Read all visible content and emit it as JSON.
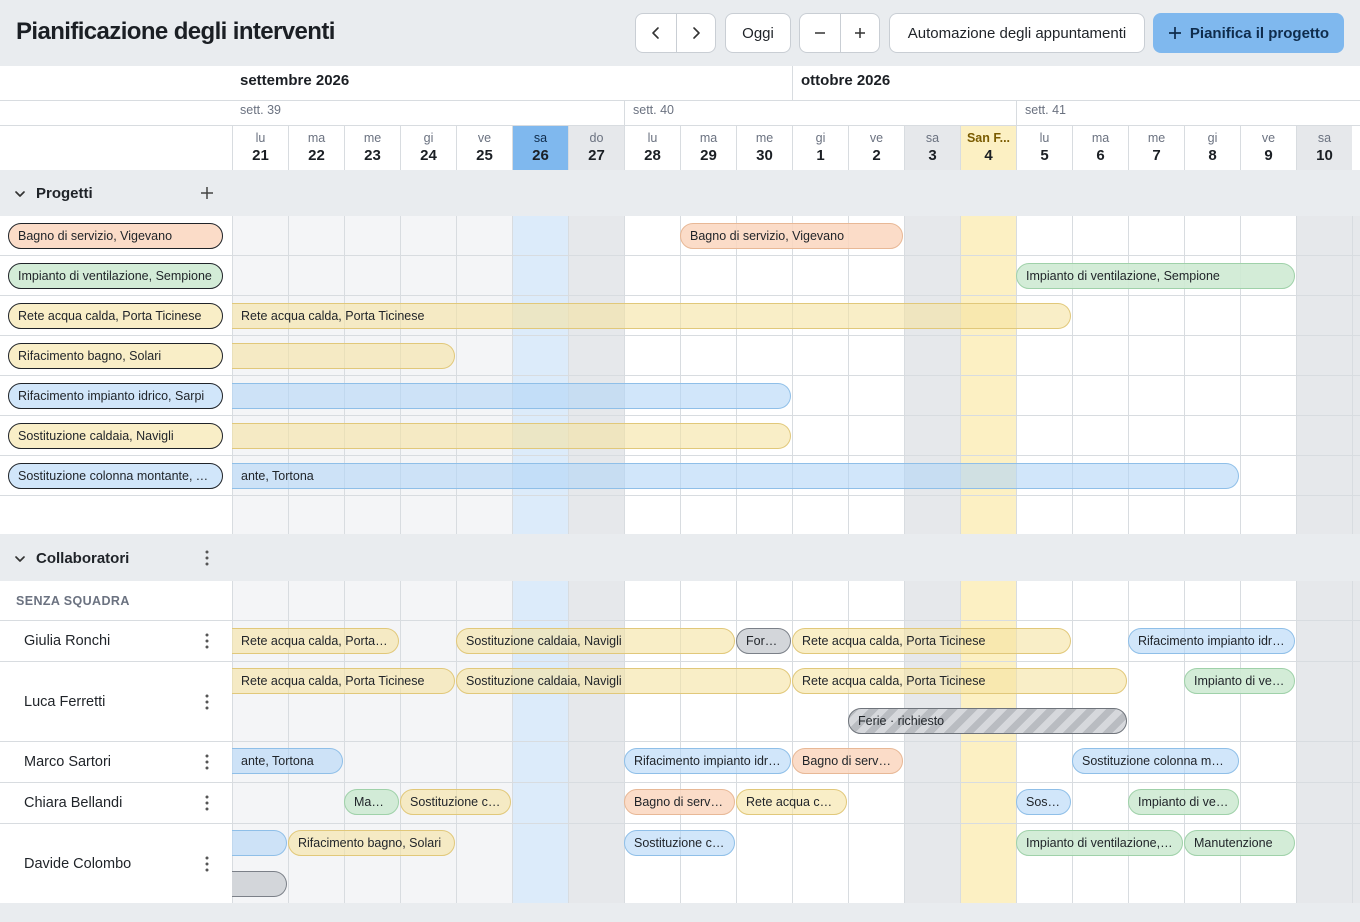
{
  "header": {
    "title": "Pianificazione degli interventi",
    "today_label": "Oggi",
    "automation_label": "Automazione degli appuntamenti",
    "plan_label": "Pianifica il progetto"
  },
  "timeline": {
    "months": [
      "settembre 2026",
      "ottobre 2026"
    ],
    "weeks": [
      "sett. 39",
      "sett. 40",
      "sett. 41"
    ],
    "days": [
      {
        "name": "lu",
        "num": "21"
      },
      {
        "name": "ma",
        "num": "22"
      },
      {
        "name": "me",
        "num": "23"
      },
      {
        "name": "gi",
        "num": "24"
      },
      {
        "name": "ve",
        "num": "25"
      },
      {
        "name": "sa",
        "num": "26"
      },
      {
        "name": "do",
        "num": "27"
      },
      {
        "name": "lu",
        "num": "28"
      },
      {
        "name": "ma",
        "num": "29"
      },
      {
        "name": "me",
        "num": "30"
      },
      {
        "name": "gi",
        "num": "1"
      },
      {
        "name": "ve",
        "num": "2"
      },
      {
        "name": "sa",
        "num": "3"
      },
      {
        "name": "San F...",
        "num": "4"
      },
      {
        "name": "lu",
        "num": "5"
      },
      {
        "name": "ma",
        "num": "6"
      },
      {
        "name": "me",
        "num": "7"
      },
      {
        "name": "gi",
        "num": "8"
      },
      {
        "name": "ve",
        "num": "9"
      },
      {
        "name": "sa",
        "num": "10"
      }
    ]
  },
  "projects": {
    "title": "Progetti",
    "items": [
      {
        "label": "Bagno di servizio, Vigevano",
        "color": "orange"
      },
      {
        "label": "Impianto di ventilazione, Sempione",
        "color": "green"
      },
      {
        "label": "Rete acqua calda, Porta Ticinese",
        "color": "yellow"
      },
      {
        "label": "Rifacimento bagno, Solari",
        "color": "yellow"
      },
      {
        "label": "Rifacimento impianto idrico, Sarpi",
        "color": "blue"
      },
      {
        "label": "Sostituzione caldaia, Navigli",
        "color": "yellow"
      },
      {
        "label": "Sostituzione colonna montante, Tortona",
        "color": "blue"
      }
    ],
    "bars": [
      {
        "text": "Bagno di servizio, Vigevano",
        "color": "orange"
      },
      {
        "text": "Impianto di ventilazione, Sempione",
        "color": "green"
      },
      {
        "text": "Rete acqua calda, Porta Ticinese",
        "color": "yellow"
      },
      {
        "text": "",
        "color": "yellow"
      },
      {
        "text": "",
        "color": "blue"
      },
      {
        "text": "",
        "color": "yellow"
      },
      {
        "text": "ante, Tortona",
        "color": "blue"
      }
    ]
  },
  "collaborators": {
    "title": "Collaboratori",
    "group": "SENZA SQUADRA",
    "people": [
      "Giulia Ronchi",
      "Luca Ferretti",
      "Marco Sartori",
      "Chiara Bellandi",
      "Davide Colombo"
    ],
    "bars": [
      {
        "text": "Rete acqua calda, Porta Ticinese",
        "color": "yellow"
      },
      {
        "text": "Sostituzione caldaia, Navigli",
        "color": "yellow"
      },
      {
        "text": "Formazione",
        "color": "grey"
      },
      {
        "text": "Rete acqua calda, Porta Ticinese",
        "color": "yellow"
      },
      {
        "text": "Rifacimento impianto idrico, Sarpi",
        "color": "blue"
      },
      {
        "text": "Rete acqua calda, Porta Ticinese",
        "color": "yellow"
      },
      {
        "text": "Sostituzione caldaia, Navigli",
        "color": "yellow"
      },
      {
        "text": "Rete acqua calda, Porta Ticinese",
        "color": "yellow"
      },
      {
        "text": "Impianto di ventilazione, Sempione",
        "color": "green"
      },
      {
        "text": "Ferie · richiesto",
        "color": "hatch"
      },
      {
        "text": "ante, Tortona",
        "color": "blue"
      },
      {
        "text": "Rifacimento impianto idrico, Sarpi",
        "color": "blue"
      },
      {
        "text": "Bagno di servizio, Vigevano",
        "color": "orange"
      },
      {
        "text": "Sostituzione colonna montante, Tortona",
        "color": "blue"
      },
      {
        "text": "Manutenzione",
        "color": "green"
      },
      {
        "text": "Sostituzione caldaia, Navigli",
        "color": "yellow"
      },
      {
        "text": "Bagno di servizio, Vigevano",
        "color": "orange"
      },
      {
        "text": "Rete acqua calda, Porta Ticinese",
        "color": "yellow"
      },
      {
        "text": "Sostituzione colonna montante, Tortona",
        "color": "blue"
      },
      {
        "text": "Impianto di ventilazione, Sempione",
        "color": "green"
      },
      {
        "text": "",
        "color": "blue"
      },
      {
        "text": "Rifacimento bagno, Solari",
        "color": "yellow"
      },
      {
        "text": "Sostituzione colonna montante, Tortona",
        "color": "blue"
      },
      {
        "text": "Impianto di ventilazione, Sempione",
        "color": "green"
      },
      {
        "text": "Manutenzione",
        "color": "green"
      },
      {
        "text": "",
        "color": "grey"
      }
    ]
  },
  "colors": {
    "accent": "#7fb8ee",
    "today_column": "#dcebfa",
    "holiday": "#fcf0c3",
    "weekend": "#e6e8eb"
  }
}
